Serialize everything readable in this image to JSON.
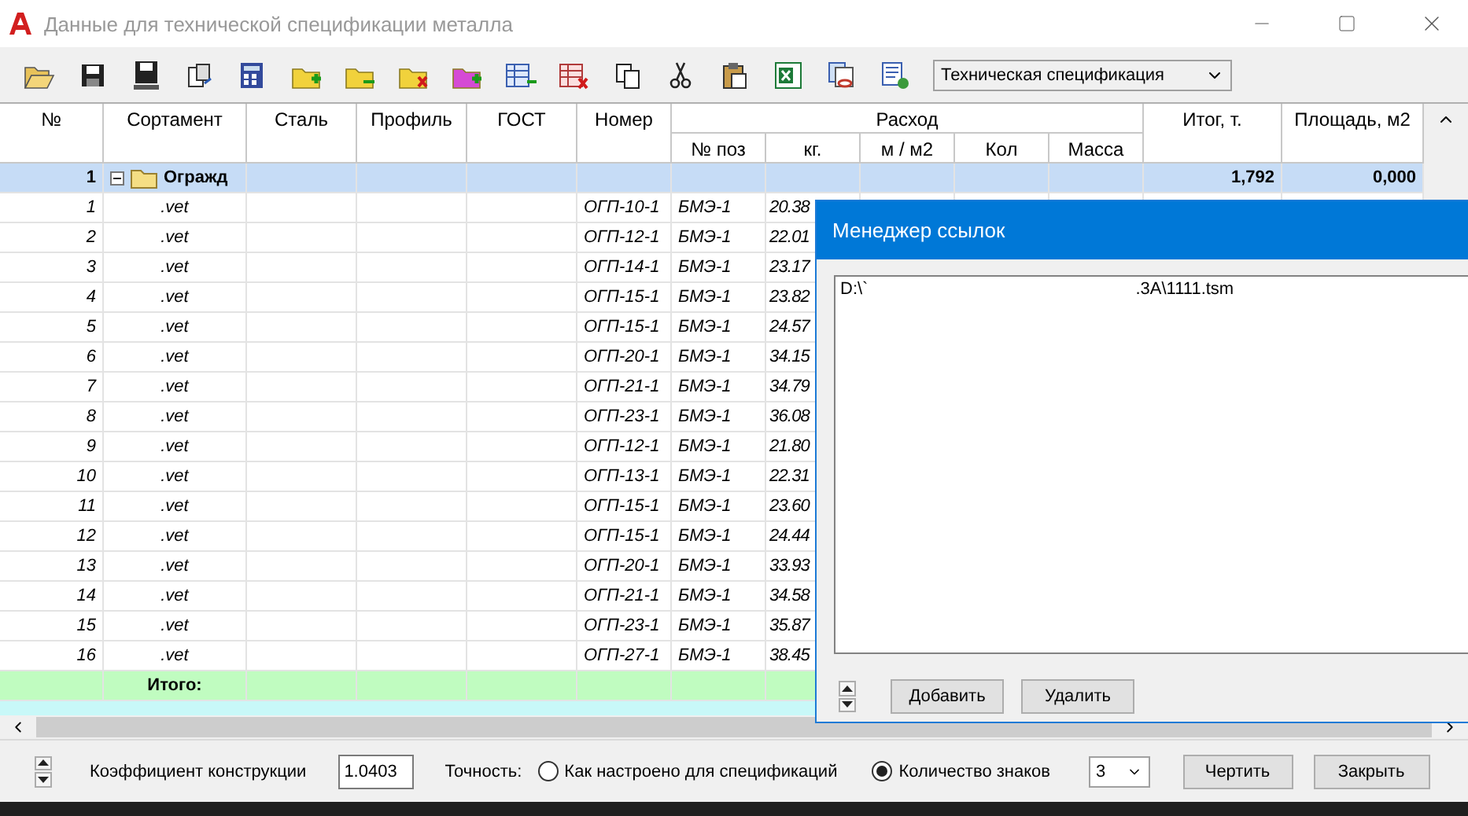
{
  "window": {
    "title": "Данные для технической спецификации металла"
  },
  "toolbar": {
    "spec_type": "Техническая спецификация"
  },
  "table": {
    "columns": [
      "№",
      "Сортамент",
      "Сталь",
      "Профиль",
      "ГОСТ",
      "Номер"
    ],
    "group_header": "Расход",
    "sub_columns": [
      "№ поз",
      "кг.",
      "м / м2",
      "Кол",
      "Масса"
    ],
    "end_columns": [
      "Итог, т.",
      "Площадь, м2"
    ],
    "group_row": {
      "number": "1",
      "name": "Огражд",
      "expanded": true,
      "total": "1,792",
      "area": "0,000"
    },
    "rows": [
      {
        "number": "1",
        "sortament": ".vet",
        "nomer": "ОГП-10-1",
        "poz": "БМЭ-1",
        "kg": "20.38"
      },
      {
        "number": "2",
        "sortament": ".vet",
        "nomer": "ОГП-12-1",
        "poz": "БМЭ-1",
        "kg": "22.01"
      },
      {
        "number": "3",
        "sortament": ".vet",
        "nomer": "ОГП-14-1",
        "poz": "БМЭ-1",
        "kg": "23.17"
      },
      {
        "number": "4",
        "sortament": ".vet",
        "nomer": "ОГП-15-1",
        "poz": "БМЭ-1",
        "kg": "23.82"
      },
      {
        "number": "5",
        "sortament": ".vet",
        "nomer": "ОГП-15-1",
        "poz": "БМЭ-1",
        "kg": "24.57"
      },
      {
        "number": "6",
        "sortament": ".vet",
        "nomer": "ОГП-20-1",
        "poz": "БМЭ-1",
        "kg": "34.15"
      },
      {
        "number": "7",
        "sortament": ".vet",
        "nomer": "ОГП-21-1",
        "poz": "БМЭ-1",
        "kg": "34.79"
      },
      {
        "number": "8",
        "sortament": ".vet",
        "nomer": "ОГП-23-1",
        "poz": "БМЭ-1",
        "kg": "36.08"
      },
      {
        "number": "9",
        "sortament": ".vet",
        "nomer": "ОГП-12-1",
        "poz": "БМЭ-1",
        "kg": "21.80"
      },
      {
        "number": "10",
        "sortament": ".vet",
        "nomer": "ОГП-13-1",
        "poz": "БМЭ-1",
        "kg": "22.31"
      },
      {
        "number": "11",
        "sortament": ".vet",
        "nomer": "ОГП-15-1",
        "poz": "БМЭ-1",
        "kg": "23.60"
      },
      {
        "number": "12",
        "sortament": ".vet",
        "nomer": "ОГП-15-1",
        "poz": "БМЭ-1",
        "kg": "24.44"
      },
      {
        "number": "13",
        "sortament": ".vet",
        "nomer": "ОГП-20-1",
        "poz": "БМЭ-1",
        "kg": "33.93"
      },
      {
        "number": "14",
        "sortament": ".vet",
        "nomer": "ОГП-21-1",
        "poz": "БМЭ-1",
        "kg": "34.58"
      },
      {
        "number": "15",
        "sortament": ".vet",
        "nomer": "ОГП-23-1",
        "poz": "БМЭ-1",
        "kg": "35.87"
      },
      {
        "number": "16",
        "sortament": ".vet",
        "nomer": "ОГП-27-1",
        "poz": "БМЭ-1",
        "kg": "38.45"
      }
    ],
    "total_row": {
      "label": "Итого:"
    }
  },
  "dialog": {
    "title": "Менеджер ссылок",
    "path_start": "D:\\`",
    "path_end": ".3A\\1111.tsm",
    "buttons": [
      "Добавить",
      "Удалить"
    ]
  },
  "footer": {
    "coefficient_label": "Коэффициент конструкции",
    "coefficient": "1.0403",
    "precision_label": "Точность:",
    "precision_options": [
      {
        "label": "Как настроено для спецификаций",
        "selected": false
      },
      {
        "label": "Количество знаков",
        "selected": true
      }
    ],
    "digits": "3",
    "buttons": [
      "Чертить",
      "Закрыть"
    ]
  }
}
